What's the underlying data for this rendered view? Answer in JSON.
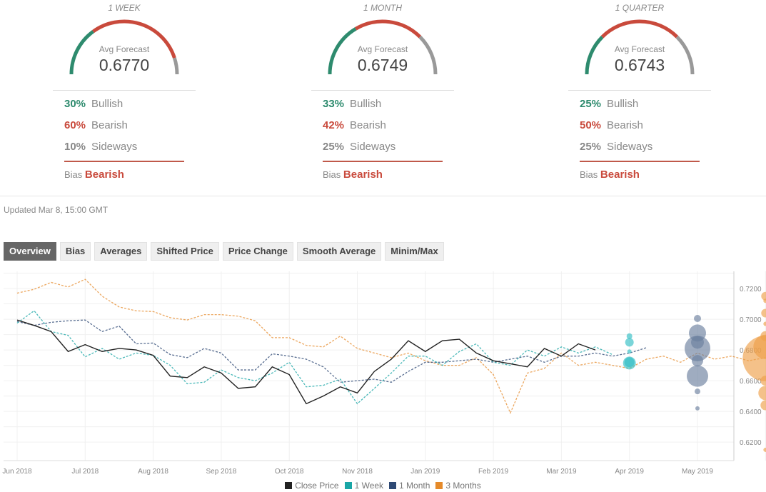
{
  "forecasts": [
    {
      "period": "1 WEEK",
      "avg_label": "Avg Forecast",
      "avg": "0.6770",
      "bullish_pct": "30%",
      "bearish_pct": "60%",
      "sideways_pct": "10%",
      "bullish_label": "Bullish",
      "bearish_label": "Bearish",
      "sideways_label": "Sideways",
      "bias_label": "Bias",
      "bias": "Bearish",
      "gauge_split": [
        30,
        60,
        10
      ]
    },
    {
      "period": "1 MONTH",
      "avg_label": "Avg Forecast",
      "avg": "0.6749",
      "bullish_pct": "33%",
      "bearish_pct": "42%",
      "sideways_pct": "25%",
      "bullish_label": "Bullish",
      "bearish_label": "Bearish",
      "sideways_label": "Sideways",
      "bias_label": "Bias",
      "bias": "Bearish",
      "gauge_split": [
        33,
        42,
        25
      ]
    },
    {
      "period": "1 QUARTER",
      "avg_label": "Avg Forecast",
      "avg": "0.6743",
      "bullish_pct": "25%",
      "bearish_pct": "50%",
      "sideways_pct": "25%",
      "bullish_label": "Bullish",
      "bearish_label": "Bearish",
      "sideways_label": "Sideways",
      "bias_label": "Bias",
      "bias": "Bearish",
      "gauge_split": [
        25,
        50,
        25
      ]
    }
  ],
  "colors": {
    "bullish": "#2e8b6e",
    "bearish": "#c94a3c",
    "sideways": "#999999"
  },
  "updated": "Updated Mar 8, 15:00 GMT",
  "tabs": [
    "Overview",
    "Bias",
    "Averages",
    "Shifted Price",
    "Price Change",
    "Smooth Average",
    "Minim/Max"
  ],
  "active_tab": "Overview",
  "chart_data": {
    "type": "line",
    "x_ticks": [
      "Jun 2018",
      "Jul 2018",
      "Aug 2018",
      "Sep 2018",
      "Oct 2018",
      "Nov 2018",
      "Jan 2019",
      "Feb 2019",
      "Mar 2019",
      "Apr 2019",
      "May 2019"
    ],
    "y_ticks": [
      "0.6200",
      "0.6400",
      "0.6600",
      "0.6800",
      "0.7000",
      "0.7200"
    ],
    "ylim": [
      0.608,
      0.7335
    ],
    "x_range_months": [
      0,
      11.5
    ],
    "grid": true,
    "legend": {
      "position": "bottom",
      "items": [
        {
          "name": "Close Price",
          "color": "#222222"
        },
        {
          "name": "1 Week",
          "color": "#1aa6a6"
        },
        {
          "name": "1 Month",
          "color": "#2f4a75"
        },
        {
          "name": "3 Months",
          "color": "#e58a2a"
        }
      ]
    },
    "series": [
      {
        "name": "Close Price",
        "color": "#222222",
        "dashed": false,
        "x": [
          0,
          0.25,
          0.5,
          0.75,
          1,
          1.25,
          1.5,
          1.75,
          2,
          2.25,
          2.5,
          2.75,
          3,
          3.25,
          3.5,
          3.75,
          4,
          4.25,
          4.5,
          4.75,
          5,
          5.25,
          5.5,
          5.75,
          6,
          6.25,
          6.5,
          6.75,
          7,
          7.25,
          7.5,
          7.75,
          8,
          8.25,
          8.5
        ],
        "y": [
          0.6995,
          0.696,
          0.692,
          0.679,
          0.6835,
          0.679,
          0.681,
          0.68,
          0.6765,
          0.663,
          0.662,
          0.669,
          0.665,
          0.655,
          0.656,
          0.669,
          0.664,
          0.645,
          0.65,
          0.656,
          0.652,
          0.666,
          0.674,
          0.686,
          0.679,
          0.686,
          0.687,
          0.678,
          0.673,
          0.671,
          0.669,
          0.681,
          0.676,
          0.684,
          0.68
        ]
      },
      {
        "name": "1 Week",
        "color": "#1aa6a6",
        "dashed": true,
        "x": [
          0,
          0.25,
          0.5,
          0.75,
          1,
          1.25,
          1.5,
          1.75,
          2,
          2.25,
          2.5,
          2.75,
          3,
          3.25,
          3.5,
          3.75,
          4,
          4.25,
          4.5,
          4.75,
          5,
          5.25,
          5.5,
          5.75,
          6,
          6.25,
          6.5,
          6.75,
          7,
          7.25,
          7.5,
          7.75,
          8,
          8.25,
          8.5,
          8.75
        ],
        "y": [
          0.6975,
          0.7055,
          0.692,
          0.6895,
          0.6755,
          0.681,
          0.674,
          0.678,
          0.6765,
          0.67,
          0.658,
          0.659,
          0.667,
          0.662,
          0.66,
          0.665,
          0.672,
          0.656,
          0.657,
          0.661,
          0.645,
          0.655,
          0.665,
          0.676,
          0.676,
          0.67,
          0.679,
          0.684,
          0.672,
          0.67,
          0.68,
          0.676,
          0.682,
          0.678,
          0.682,
          0.677
        ]
      },
      {
        "name": "1 Month",
        "color": "#2f4a75",
        "dashed": true,
        "x": [
          0,
          0.25,
          0.5,
          0.75,
          1,
          1.25,
          1.5,
          1.75,
          2,
          2.25,
          2.5,
          2.75,
          3,
          3.25,
          3.5,
          3.75,
          4,
          4.25,
          4.5,
          4.75,
          5,
          5.25,
          5.5,
          5.75,
          6,
          6.25,
          6.5,
          6.75,
          7,
          7.25,
          7.5,
          7.75,
          8,
          8.25,
          8.5,
          8.75,
          9,
          9.25
        ],
        "y": [
          0.6985,
          0.696,
          0.698,
          0.699,
          0.6995,
          0.692,
          0.6955,
          0.684,
          0.6845,
          0.677,
          0.675,
          0.681,
          0.678,
          0.667,
          0.667,
          0.6775,
          0.676,
          0.674,
          0.669,
          0.659,
          0.66,
          0.661,
          0.659,
          0.666,
          0.672,
          0.672,
          0.673,
          0.674,
          0.672,
          0.674,
          0.676,
          0.672,
          0.676,
          0.676,
          0.678,
          0.676,
          0.678,
          0.6815
        ]
      },
      {
        "name": "3 Months",
        "color": "#e58a2a",
        "dashed": true,
        "x": [
          0,
          0.25,
          0.5,
          0.75,
          1,
          1.25,
          1.5,
          1.75,
          2,
          2.25,
          2.5,
          2.75,
          3,
          3.25,
          3.5,
          3.75,
          4,
          4.25,
          4.5,
          4.75,
          5,
          5.25,
          5.5,
          5.75,
          6,
          6.25,
          6.5,
          6.75,
          7,
          7.25,
          7.5,
          7.75,
          8,
          8.25,
          8.5,
          8.75,
          9,
          9.25,
          9.5,
          9.75,
          10,
          10.25,
          10.5,
          10.75,
          11
        ],
        "y": [
          0.717,
          0.7195,
          0.724,
          0.721,
          0.726,
          0.715,
          0.708,
          0.7055,
          0.705,
          0.701,
          0.6995,
          0.703,
          0.703,
          0.702,
          0.699,
          0.688,
          0.688,
          0.683,
          0.682,
          0.689,
          0.681,
          0.678,
          0.675,
          0.678,
          0.673,
          0.67,
          0.67,
          0.675,
          0.664,
          0.639,
          0.665,
          0.668,
          0.678,
          0.67,
          0.672,
          0.67,
          0.668,
          0.674,
          0.676,
          0.672,
          0.678,
          0.674,
          0.676,
          0.673,
          0.675
        ]
      }
    ],
    "bubbles": [
      {
        "series": "1 Week",
        "color": "#33bfc4",
        "x": 9.0,
        "points": [
          {
            "y": 0.689,
            "r": 4
          },
          {
            "y": 0.685,
            "r": 6
          },
          {
            "y": 0.679,
            "r": 3
          },
          {
            "y": 0.672,
            "r": 7
          },
          {
            "y": 0.6715,
            "r": 9
          }
        ]
      },
      {
        "series": "1 Month",
        "color": "#6b7f9e",
        "x": 10.0,
        "points": [
          {
            "y": 0.7005,
            "r": 5
          },
          {
            "y": 0.691,
            "r": 12
          },
          {
            "y": 0.685,
            "r": 9
          },
          {
            "y": 0.681,
            "r": 18
          },
          {
            "y": 0.673,
            "r": 8
          },
          {
            "y": 0.663,
            "r": 15
          },
          {
            "y": 0.653,
            "r": 4
          },
          {
            "y": 0.642,
            "r": 3
          }
        ]
      },
      {
        "series": "3 Months",
        "color": "#eea04a",
        "x": 11.0,
        "points": [
          {
            "y": 0.715,
            "r": 6
          },
          {
            "y": 0.712,
            "r": 3
          },
          {
            "y": 0.704,
            "r": 6
          },
          {
            "y": 0.697,
            "r": 3
          },
          {
            "y": 0.689,
            "r": 7
          },
          {
            "y": 0.682,
            "r": 17
          },
          {
            "y": 0.6745,
            "r": 32
          },
          {
            "y": 0.66,
            "r": 7
          },
          {
            "y": 0.652,
            "r": 10
          },
          {
            "y": 0.644,
            "r": 7
          },
          {
            "y": 0.615,
            "r": 3
          }
        ]
      }
    ]
  }
}
